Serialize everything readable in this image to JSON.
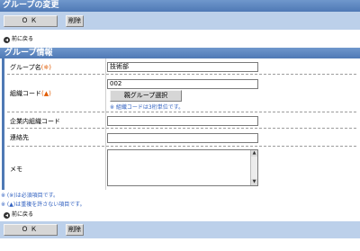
{
  "window": {
    "title": "グループの変更"
  },
  "toolbar": {
    "ok_label": "ＯＫ",
    "delete_label": "削除"
  },
  "nav": {
    "back_label": "前に戻る",
    "back_icon": "back-arrow-icon"
  },
  "section": {
    "title": "グループ情報"
  },
  "fields": {
    "group_name": {
      "label": "グループ名",
      "mark": "(※)",
      "value": "技術部"
    },
    "org_code": {
      "label": "組織コード",
      "mark": "(▲)",
      "value": "002",
      "pick_button": "親グループ選択",
      "note": "※ 組織コードは3桁単位です。"
    },
    "internal_code": {
      "label": "企業内組織コード",
      "value": ""
    },
    "contact": {
      "label": "連絡先",
      "value": ""
    },
    "memo": {
      "label": "メモ",
      "value": ""
    }
  },
  "notes": {
    "required": "※ (※)は必須項目です。",
    "no_duplicate": "※ (▲)は重複を許さない項目です。"
  },
  "colors": {
    "header": "#5a83bd",
    "toolbar": "#bcd0ea",
    "required_mark": "#e05a00",
    "note_blue": "#3060c0"
  }
}
